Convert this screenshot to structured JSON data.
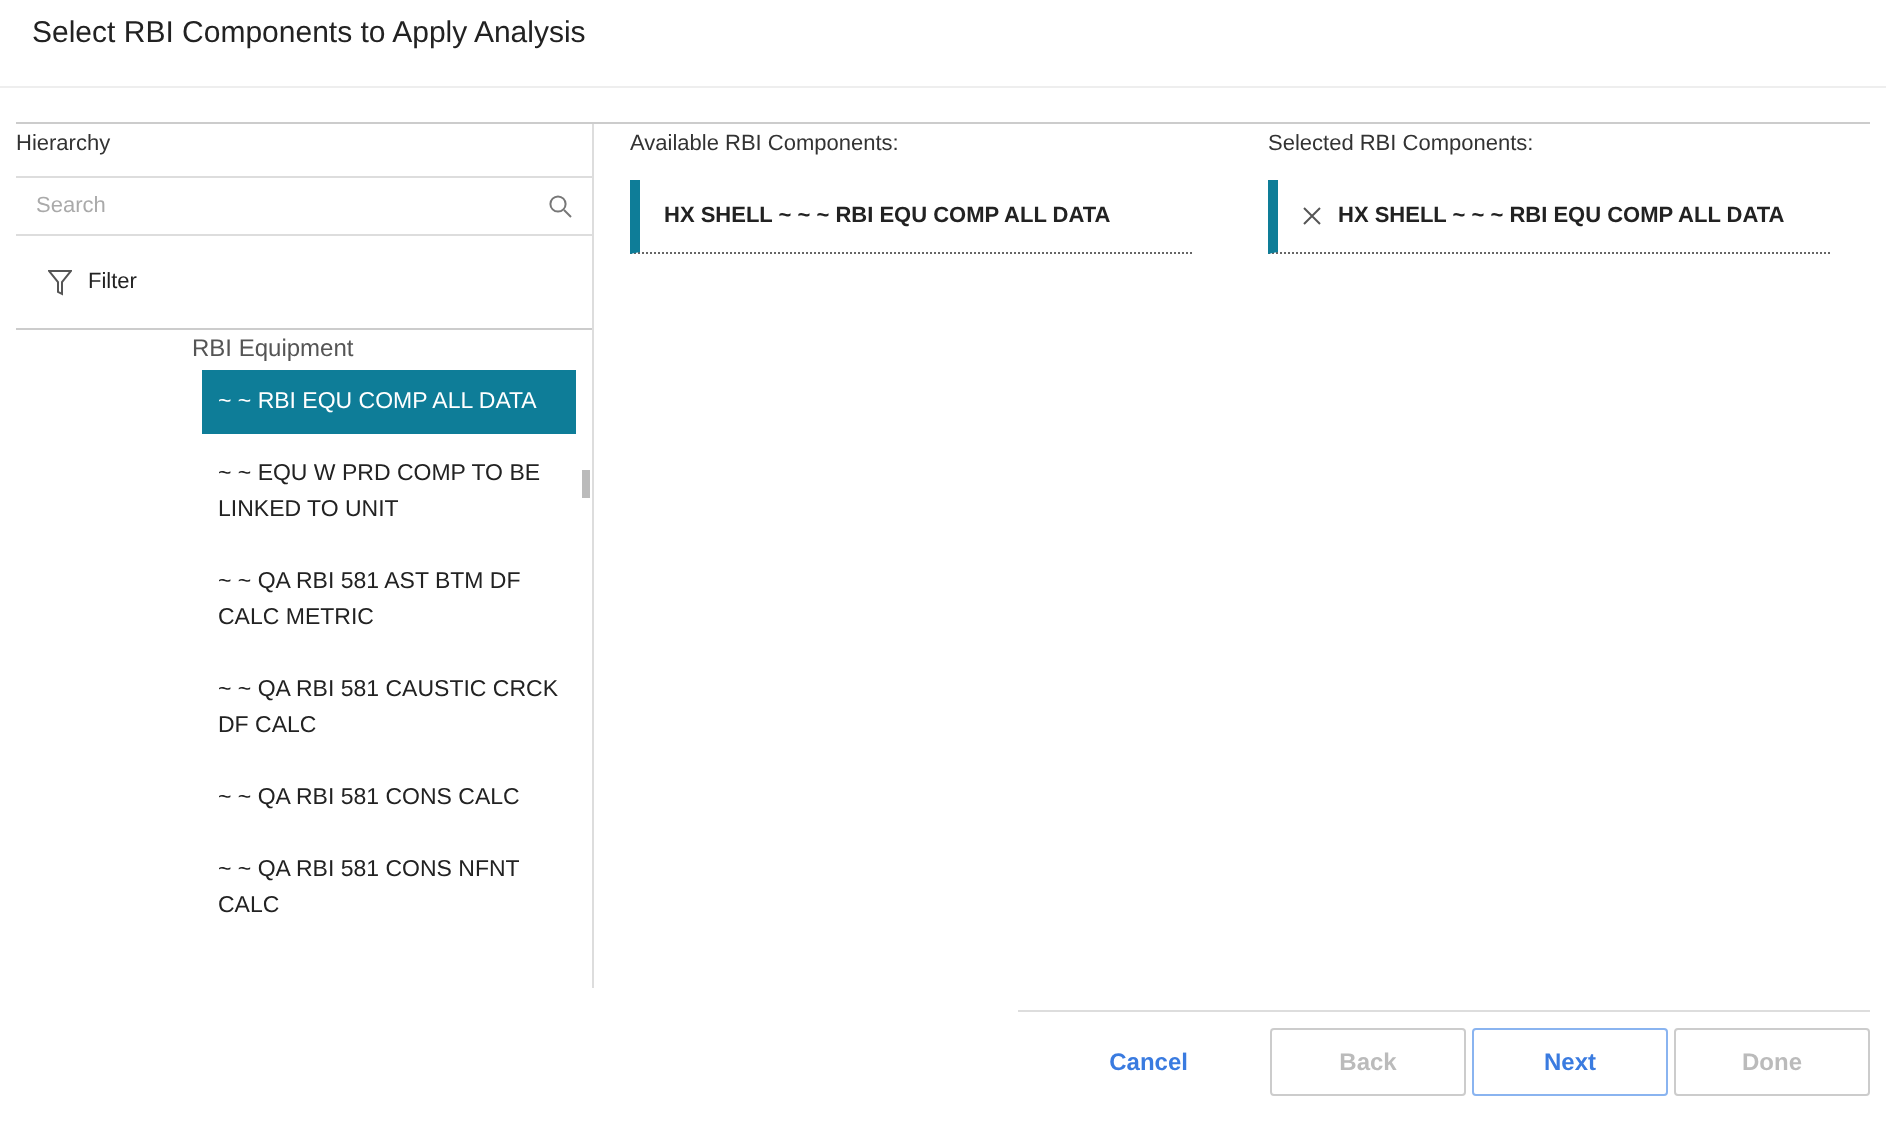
{
  "dialog": {
    "title": "Select RBI Components to Apply Analysis"
  },
  "hierarchy": {
    "label": "Hierarchy",
    "search": {
      "placeholder": "Search"
    },
    "filter": "Filter",
    "parent": "RBI Equipment",
    "items": [
      {
        "label": "~ ~ RBI EQU COMP ALL DATA",
        "selected": true
      },
      {
        "label": "~ ~ EQU W PRD COMP TO BE LINKED TO UNIT",
        "selected": false
      },
      {
        "label": "~ ~ QA RBI 581 AST BTM DF CALC METRIC",
        "selected": false
      },
      {
        "label": "~ ~ QA RBI 581 CAUSTIC CRCK DF CALC",
        "selected": false
      },
      {
        "label": "~ ~ QA RBI 581 CONS CALC",
        "selected": false
      },
      {
        "label": "~ ~ QA RBI 581 CONS NFNT CALC",
        "selected": false
      }
    ]
  },
  "available": {
    "label": "Available RBI Components:",
    "items": [
      {
        "label": "HX SHELL ~ ~ ~ RBI EQU COMP ALL DATA"
      }
    ]
  },
  "selected_components": {
    "label": "Selected RBI Components:",
    "items": [
      {
        "label": "HX SHELL ~ ~ ~ RBI EQU COMP ALL DATA"
      }
    ]
  },
  "footer": {
    "cancel": "Cancel",
    "buttons": [
      {
        "label": "Back",
        "disabled": true
      },
      {
        "label": "Next",
        "disabled": false
      },
      {
        "label": "Done",
        "disabled": true
      }
    ]
  }
}
